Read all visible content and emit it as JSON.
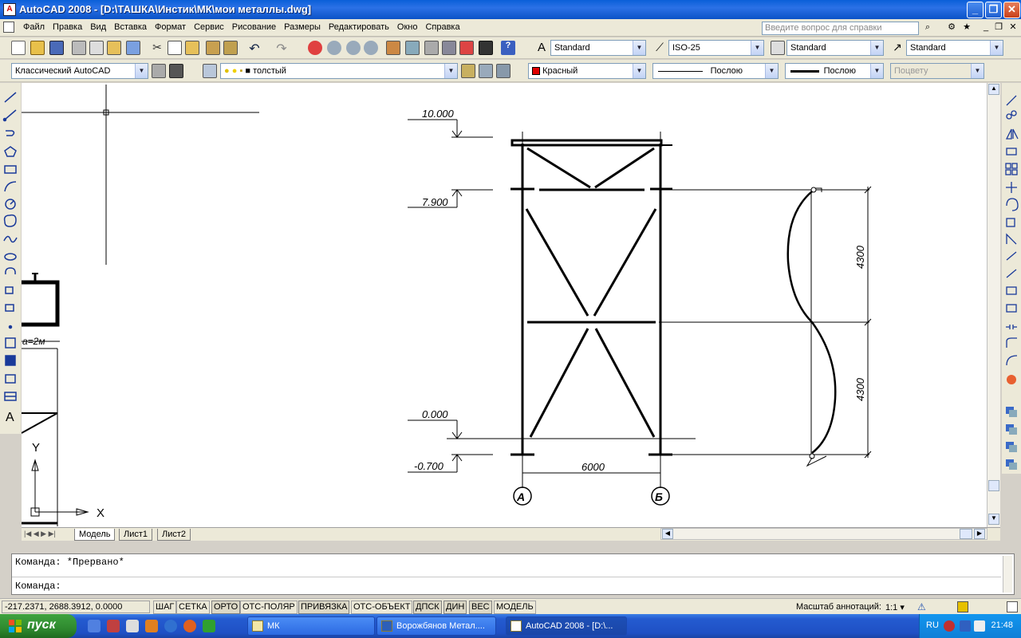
{
  "window": {
    "title": "AutoCAD 2008 - [D:\\ТАШКА\\Инстик\\МК\\мои металлы.dwg]",
    "buttons": [
      "minimize",
      "maximize",
      "close"
    ]
  },
  "menu": {
    "items": [
      "Файл",
      "Правка",
      "Вид",
      "Вставка",
      "Формат",
      "Сервис",
      "Рисование",
      "Размеры",
      "Редактировать",
      "Окно",
      "Справка"
    ],
    "help_search_placeholder": "Введите вопрос для справки"
  },
  "toolbar_styles": {
    "text_style": "Standard",
    "dim_style": "ISO-25",
    "table_style": "Standard",
    "multileader_style": "Standard"
  },
  "toolbar_layers": {
    "workspace": "Классический AutoCAD",
    "layer": "толстый",
    "color": "Красный",
    "color_hex": "#e00000",
    "linetype": "Послою",
    "lineweight": "Послою",
    "plotstyle": "Поцвету"
  },
  "drawing": {
    "levels": [
      "10.000",
      "7.900",
      "0.000",
      "-0.700"
    ],
    "dims": [
      "4300",
      "4300",
      "6000"
    ],
    "axes": [
      "А",
      "Б"
    ],
    "left_note": "a=2м",
    "ucs_x": "X",
    "ucs_y": "Y"
  },
  "layout_tabs": [
    "Модель",
    "Лист1",
    "Лист2"
  ],
  "command": {
    "history": "Команда: *Прервано*",
    "prompt": "Команда:"
  },
  "status": {
    "coords": "-217.2371, 2688.3912, 0.0000",
    "toggles": [
      "ШАГ",
      "СЕТКА",
      "ОРТО",
      "ОТС-ПОЛЯР",
      "ПРИВЯЗКА",
      "ОТС-ОБЪЕКТ",
      "ДПСК",
      "ДИН",
      "ВЕС",
      "МОДЕЛЬ"
    ],
    "annotation_scale_label": "Масштаб аннотаций:",
    "annotation_scale": "1:1"
  },
  "taskbar": {
    "start": "пуск",
    "tasks": [
      "МК",
      "Ворожбянов Метал....",
      "AutoCAD 2008 - [D:\\..."
    ],
    "lang": "RU",
    "time": "21:48"
  }
}
